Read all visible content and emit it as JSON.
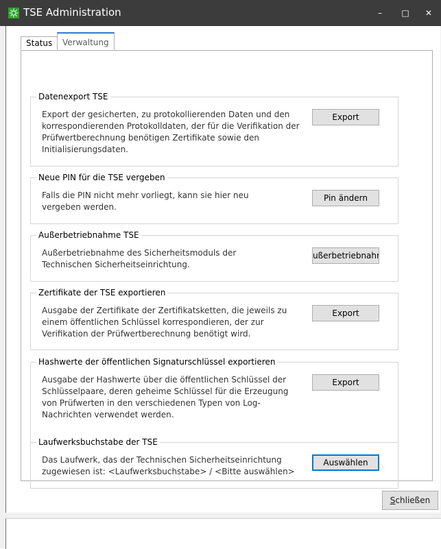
{
  "window": {
    "title": "TSE Administration",
    "minimize_glyph": "–",
    "maximize_glyph": "□",
    "close_glyph": "✕"
  },
  "tabs": [
    {
      "label": "Status",
      "active": false
    },
    {
      "label": "Verwaltung",
      "active": true
    }
  ],
  "groups": [
    {
      "title": "Datenexport TSE",
      "description": "Export der gesicherten, zu protokollierenden Daten und den korrespondierenden Protokolldaten, der für die Verifikation der Prüfwertberechnung benötigen Zertifikate sowie den Initialisierungsdaten.",
      "button_label": "Export"
    },
    {
      "title": "Neue PIN für die TSE vergeben",
      "description": "Falls die PIN nicht mehr vorliegt, kann sie hier neu vergeben werden.",
      "button_label": "Pin ändern"
    },
    {
      "title": "Außerbetriebnahme TSE",
      "description": "Außerbetriebnahme des Sicherheitsmoduls der Technischen Sicherheitseinrichtung.",
      "button_label": "ußerbetriebnahm"
    },
    {
      "title": "Zertifikate der TSE exportieren",
      "description": "Ausgabe der Zertifikate der Zertifikatsketten, die jeweils zu einem öffentlichen Schlüssel korrespondieren, der zur Verifikation der Prüfwertberechnung benötigt wird.",
      "button_label": "Export"
    },
    {
      "title": "Hashwerte der öffentlichen Signaturschlüssel exportieren",
      "description": "Ausgabe der Hashwerte über die öffentlichen Schlüssel der Schlüsselpaare, deren geheime Schlüssel für die Erzeugung von Prüfwerten in den verschiedenen Typen von Log-Nachrichten verwendet werden.",
      "button_label": "Export"
    },
    {
      "title": "Laufwerksbuchstabe der TSE",
      "description": "Das Laufwerk, das der Technischen Sicherheitseinrichtung zugewiesen ist: <Laufwerksbuchstabe> / <Bitte auswählen>",
      "button_label": "Auswählen"
    }
  ],
  "footer": {
    "close_mnemonic": "S",
    "close_rest": "chließen"
  },
  "colors": {
    "titlebar": "#3c3c3c",
    "icon_green": "#2f9e2f",
    "tab_accent": "#3277d6",
    "button_face": "#e1e1e1",
    "focus_border": "#0078d7"
  }
}
